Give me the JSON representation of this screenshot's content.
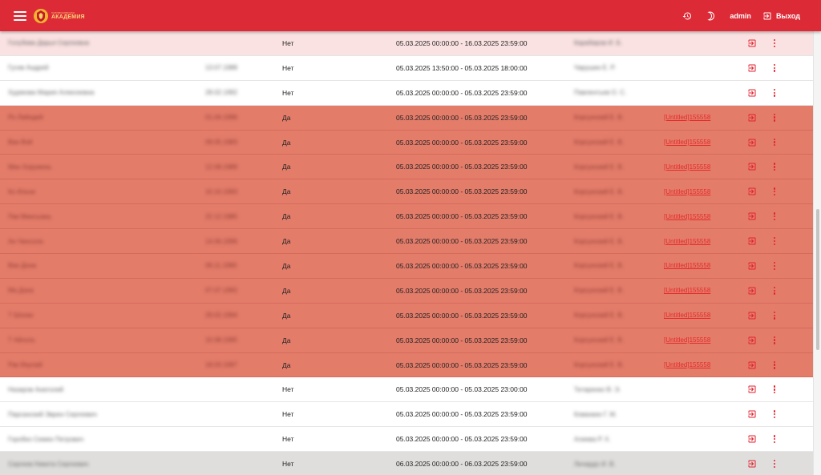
{
  "appbar": {
    "logo_small": "ХАЛИМОНОВСКАЯ",
    "logo_big": "АКАДЕМИЯ",
    "user": "admin",
    "logout_label": "Выход"
  },
  "rows": [
    {
      "style": "pink",
      "name": "Голубева Дарья Сергеевна",
      "dob": "",
      "flag": "Нет",
      "period": "05.03.2025 00:00:00 - 16.03.2025 23:59:00",
      "operator": "Карабиров И. Б.",
      "link": ""
    },
    {
      "style": "white",
      "name": "Гусев Андрей",
      "dob": "13.07.1988",
      "flag": "Нет",
      "period": "05.03.2025 13:50:00 - 05.03.2025 18:00:00",
      "operator": "Чарушин Е. Р.",
      "link": ""
    },
    {
      "style": "white",
      "name": "Худякова Мария Алексеевна",
      "dob": "28.02.1992",
      "flag": "Нет",
      "period": "05.03.2025 00:00:00 - 05.03.2025 23:59:00",
      "operator": "Павлентьев О. С.",
      "link": ""
    },
    {
      "style": "red",
      "name": "Ро Лайодей",
      "dob": "01.04.1996",
      "flag": "Да",
      "period": "05.03.2025 00:00:00 - 05.03.2025 23:59:00",
      "operator": "Корсунский Е. В.",
      "link": "[Untitled]155558"
    },
    {
      "style": "red",
      "name": "Ван Вэй",
      "dob": "09.05.1983",
      "flag": "Да",
      "period": "05.03.2025 00:00:00 - 05.03.2025 23:59:00",
      "operator": "Корсунский Е. В.",
      "link": "[Untitled]155558"
    },
    {
      "style": "red",
      "name": "Мин Хоружень",
      "dob": "12.08.1989",
      "flag": "Да",
      "period": "05.03.2025 00:00:00 - 05.03.2025 23:59:00",
      "operator": "Корсунский Е. В.",
      "link": "[Untitled]155558"
    },
    {
      "style": "red",
      "name": "Ко Ильчи",
      "dob": "10.10.1993",
      "flag": "Да",
      "period": "05.03.2025 00:00:00 - 05.03.2025 23:59:00",
      "operator": "Корсунский Е. В.",
      "link": "[Untitled]155558"
    },
    {
      "style": "red",
      "name": "Пак Минсыань",
      "dob": "22.12.1985",
      "flag": "Да",
      "period": "05.03.2025 00:00:00 - 05.03.2025 23:59:00",
      "operator": "Корсунский Е. В.",
      "link": "[Untitled]155558"
    },
    {
      "style": "red",
      "name": "Ан Чинсола",
      "dob": "14.06.1996",
      "flag": "Да",
      "period": "05.03.2025 00:00:00 - 05.03.2025 23:59:00",
      "operator": "Корсунский Е. В.",
      "link": "[Untitled]155558"
    },
    {
      "style": "red",
      "name": "Ван Дона",
      "dob": "09.11.1990",
      "flag": "Да",
      "period": "05.03.2025 00:00:00 - 05.03.2025 23:59:00",
      "operator": "Корсунский Е. В.",
      "link": "[Untitled]155558"
    },
    {
      "style": "red",
      "name": "Ма Дэна",
      "dob": "07.07.1992",
      "flag": "Да",
      "period": "05.03.2025 00:00:00 - 05.03.2025 23:59:00",
      "operator": "Корсунский Е. В.",
      "link": "[Untitled]155558"
    },
    {
      "style": "red",
      "name": "Т Шохан",
      "dob": "29.02.1994",
      "flag": "Да",
      "period": "05.03.2025 00:00:00 - 05.03.2025 23:59:00",
      "operator": "Корсунский Е. В.",
      "link": "[Untitled]155558"
    },
    {
      "style": "red",
      "name": "Т Айхоль",
      "dob": "10.08.1995",
      "flag": "Да",
      "period": "05.03.2025 00:00:00 - 05.03.2025 23:59:00",
      "operator": "Корсунский Е. В.",
      "link": "[Untitled]155558"
    },
    {
      "style": "red",
      "name": "Рак Инулай",
      "dob": "18.03.1997",
      "flag": "Да",
      "period": "05.03.2025 00:00:00 - 05.03.2025 23:59:00",
      "operator": "Корсунский Е. В.",
      "link": "[Untitled]155558"
    },
    {
      "style": "white",
      "name": "Назаров Анатолий",
      "dob": "",
      "flag": "Нет",
      "period": "05.03.2025 00:00:00 - 05.03.2025 23:00:00",
      "operator": "Титаренко В. Э.",
      "link": ""
    },
    {
      "style": "white",
      "name": "Парсанский Эврен Сергеевич",
      "dob": "",
      "flag": "Нет",
      "period": "05.03.2025 00:00:00 - 05.03.2025 23:59:00",
      "operator": "Кованкин Г. М.",
      "link": ""
    },
    {
      "style": "white",
      "name": "Горобко Семен Петрович",
      "dob": "",
      "flag": "Нет",
      "period": "05.03.2025 00:00:00 - 05.03.2025 23:59:00",
      "operator": "Алиева Р. Х.",
      "link": ""
    },
    {
      "style": "grey",
      "name": "Сергеев Никита Сергеевич",
      "dob": "",
      "flag": "Нет",
      "period": "06.03.2025 00:00:00 - 06.03.2025 23:59:00",
      "operator": "Личардо И. В.",
      "link": ""
    }
  ],
  "colors": {
    "appbar": "#dc2b37",
    "row_red": "#e47c6a",
    "row_pink": "#fbe2e2",
    "row_grey": "#e0dedd",
    "action_red": "#e0222e"
  },
  "icons": {
    "menu": "hamburger-icon",
    "history": "history-icon",
    "theme": "moon-icon",
    "logout": "logout-icon",
    "row_enter": "enter-icon",
    "row_more": "more-vert-icon"
  },
  "scroll_position": 0.42
}
